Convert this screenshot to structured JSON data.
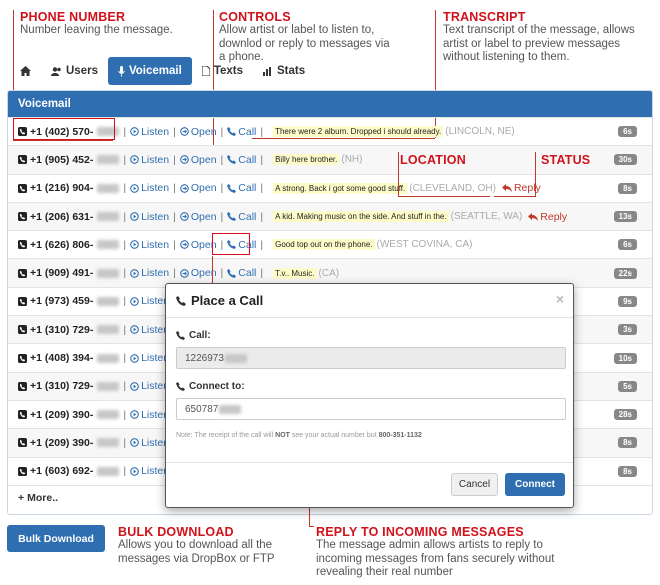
{
  "annotations": {
    "phone_number": {
      "title": "PHONE NUMBER",
      "desc": "Number leaving the message."
    },
    "controls": {
      "title": "CONTROLS",
      "desc": "Allow artist or label to listen to, downlod or reply to messages via a phone."
    },
    "transcript": {
      "title": "TRANSCRIPT",
      "desc": "Text transcript of the message, allows artist or label to preview messages without listening to them."
    },
    "location": {
      "title": "LOCATION"
    },
    "status": {
      "title": "STATUS"
    },
    "bulk_download": {
      "title": "BULK DOWNLOAD",
      "desc": "Allows you to download all the messages via DropBox or FTP"
    },
    "reply": {
      "title": "REPLY TO INCOMING MESSAGES",
      "desc": "The message admin allows artists to reply to incoming messages from fans securely without revealing their real number"
    }
  },
  "tabs": [
    {
      "label": "",
      "icon": "home-icon"
    },
    {
      "label": "Users",
      "icon": "users-icon"
    },
    {
      "label": "Voicemail",
      "icon": "microphone-icon",
      "active": true
    },
    {
      "label": "Texts",
      "icon": "file-icon"
    },
    {
      "label": "Stats",
      "icon": "bar-chart-icon"
    }
  ],
  "panel_title": "Voicemail",
  "row_actions": {
    "listen": "Listen",
    "open": "Open",
    "call": "Call",
    "reply": "Reply"
  },
  "rows": [
    {
      "phone": "+1 (402) 570-",
      "open": true,
      "call": true,
      "transcript": "There were 2 album. Dropped i should already.",
      "location": "(LINCOLN, NE)",
      "duration": "6s",
      "reply": false
    },
    {
      "phone": "+1 (905) 452-",
      "open": true,
      "call": true,
      "transcript": "Billy here brother.",
      "location": "(NH)",
      "duration": "30s",
      "reply": false
    },
    {
      "phone": "+1 (216) 904-",
      "open": true,
      "call": true,
      "transcript": "A strong. Back i got some good stuff.",
      "location": "(CLEVELAND, OH)",
      "duration": "8s",
      "reply": true
    },
    {
      "phone": "+1 (206) 631-",
      "open": true,
      "call": true,
      "transcript": "A kid. Making music on the side. And stuff in the.",
      "location": "(SEATTLE, WA)",
      "duration": "13s",
      "reply": true
    },
    {
      "phone": "+1 (626) 806-",
      "open": true,
      "call": true,
      "transcript": "Good top out on the phone.",
      "location": "(WEST COVINA, CA)",
      "duration": "6s",
      "reply": false
    },
    {
      "phone": "+1 (909) 491-",
      "open": true,
      "call": true,
      "transcript": "T.v.. Music.",
      "location": "(CA)",
      "duration": "22s",
      "reply": false
    },
    {
      "phone": "+1 (973) 459-",
      "open": false,
      "call": false,
      "transcript": "",
      "location": "",
      "duration": "9s",
      "reply": false
    },
    {
      "phone": "+1 (310) 729-",
      "open": false,
      "call": false,
      "transcript": "",
      "location": "",
      "duration": "3s",
      "reply": false
    },
    {
      "phone": "+1 (408) 394-",
      "open": false,
      "call": false,
      "transcript": "",
      "location": "",
      "duration": "10s",
      "reply": false
    },
    {
      "phone": "+1 (310) 729-",
      "open": false,
      "call": false,
      "transcript": "",
      "location": "",
      "duration": "5s",
      "reply": false
    },
    {
      "phone": "+1 (209) 390-",
      "open": false,
      "call": false,
      "transcript": "",
      "location": "",
      "duration": "28s",
      "reply": false
    },
    {
      "phone": "+1 (209) 390-",
      "open": false,
      "call": false,
      "transcript": "",
      "location": "",
      "duration": "8s",
      "reply": false
    },
    {
      "phone": "+1 (603) 692-",
      "open": false,
      "call": false,
      "transcript": "",
      "location": "",
      "duration": "8s",
      "reply": false
    }
  ],
  "more_label": "More..",
  "bulk_download_label": "Bulk Download",
  "modal": {
    "title": "Place a Call",
    "close": "×",
    "call_label": "Call:",
    "call_value": "1226973",
    "connect_label": "Connect to:",
    "connect_value": "650787",
    "note_prefix": "Note: The receipt of the call will ",
    "note_bold": "NOT",
    "note_mid": " see your actual number but ",
    "note_number": "800-351-1132",
    "cancel_label": "Cancel",
    "connect_button_label": "Connect"
  },
  "colors": {
    "accent": "#2f6eb0",
    "annotation": "#d0121b",
    "transcript_bg": "#fdfcc9"
  }
}
